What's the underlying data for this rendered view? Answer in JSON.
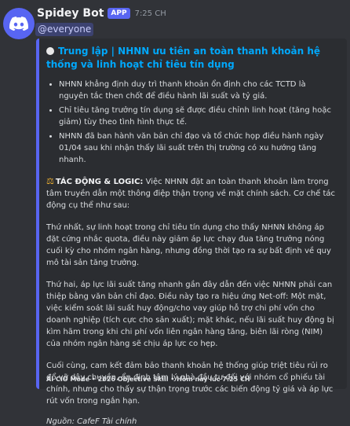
{
  "bot": {
    "name": "Spidey Bot",
    "badge": "APP",
    "time": "7:25 CH",
    "avatar_color": "#5865f2"
  },
  "mention": "@everyone",
  "embed": {
    "accent_color": "#5865f2",
    "title": "Trung lập | NHNN ưu tiên an toàn thanh khoản hệ thống và linh hoạt chỉ tiêu tín dụng",
    "bullets": [
      "NHNN khẳng định duy trì thanh khoản ổn định cho các TCTD là nguyên tắc then chốt để điều hành lãi suất và tỷ giá.",
      "Chỉ tiêu tăng trưởng tín dụng sẽ được điều chỉnh linh hoạt (tăng hoặc giảm) tùy theo tình hình thực tế.",
      "NHNN đã ban hành văn bản chỉ đạo và tổ chức họp điều hành ngày 01/04 sau khi nhận thấy lãi suất trên thị trường có xu hướng tăng nhanh."
    ],
    "impact_label": "TÁC ĐỘNG & LOGIC:",
    "impact_text": " Việc NHNN đặt an toàn thanh khoản làm trọng tâm truyền dẫn một thông điệp thận trọng về mặt chính sách. Cơ chế tác động cụ thể như sau:",
    "paragraphs": [
      "Thứ nhất, sự linh hoạt trong chỉ tiêu tín dụng cho thấy NHNN không áp đặt cứng nhắc quota, điều này giảm áp lực chạy đua tăng trưởng nóng cuối kỳ cho nhóm ngân hàng, nhưng đồng thời tạo ra sự bất định về quy mô tài sản tăng trưởng.",
      "Thứ hai, áp lực lãi suất tăng nhanh gần đây dẫn đến việc NHNN phải can thiệp bằng văn bản chỉ đạo. Điều này tạo ra hiệu ứng Net-off: Một mặt, việc kiểm soát lãi suất huy động/cho vay giúp hỗ trợ chi phí vốn cho doanh nghiệp (tích cực cho sản xuất); mặt khác, nếu lãi suất huy động bị kìm hãm trong khi chi phí vốn liên ngân hàng tăng, biên lãi ròng (NIM) của nhóm ngân hàng sẽ chịu áp lực co hẹp.",
      "Cuối cùng, cam kết đảm bảo thanh khoản hệ thống giúp triệt tiêu rủi ro đổ vỡ dây chuyền, ổn định tâm lý nhà đầu tư đối với nhóm cổ phiếu tài chính, nhưng cho thấy sự thận trọng trước các biến động tỷ giá và áp lực rút vốn trong ngắn hạn."
    ],
    "source": "Nguồn: CafeF Tài chính",
    "footer": "AI CIO Mode • 2026 Objective Skill • Hôm nay lúc 7:25 CH"
  }
}
